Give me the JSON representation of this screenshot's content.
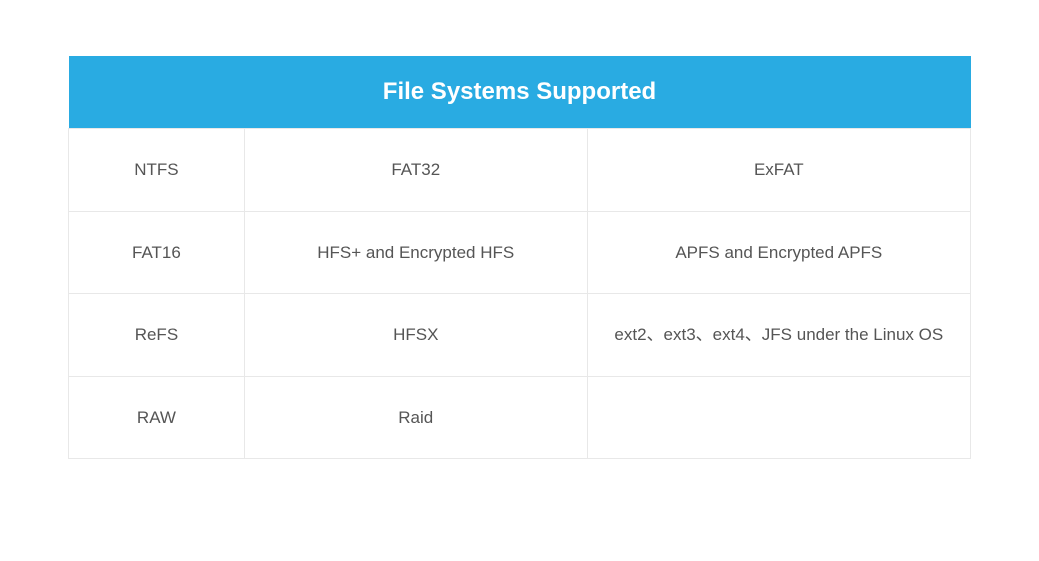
{
  "title": "File Systems Supported",
  "rows": [
    {
      "c1": "NTFS",
      "c2": "FAT32",
      "c3": "ExFAT"
    },
    {
      "c1": "FAT16",
      "c2": "HFS+ and Encrypted  HFS",
      "c3": "APFS and Encrypted APFS"
    },
    {
      "c1": "ReFS",
      "c2": "HFSX",
      "c3": "ext2、ext3、ext4、JFS under the Linux OS"
    },
    {
      "c1": "RAW",
      "c2": "Raid",
      "c3": ""
    }
  ]
}
